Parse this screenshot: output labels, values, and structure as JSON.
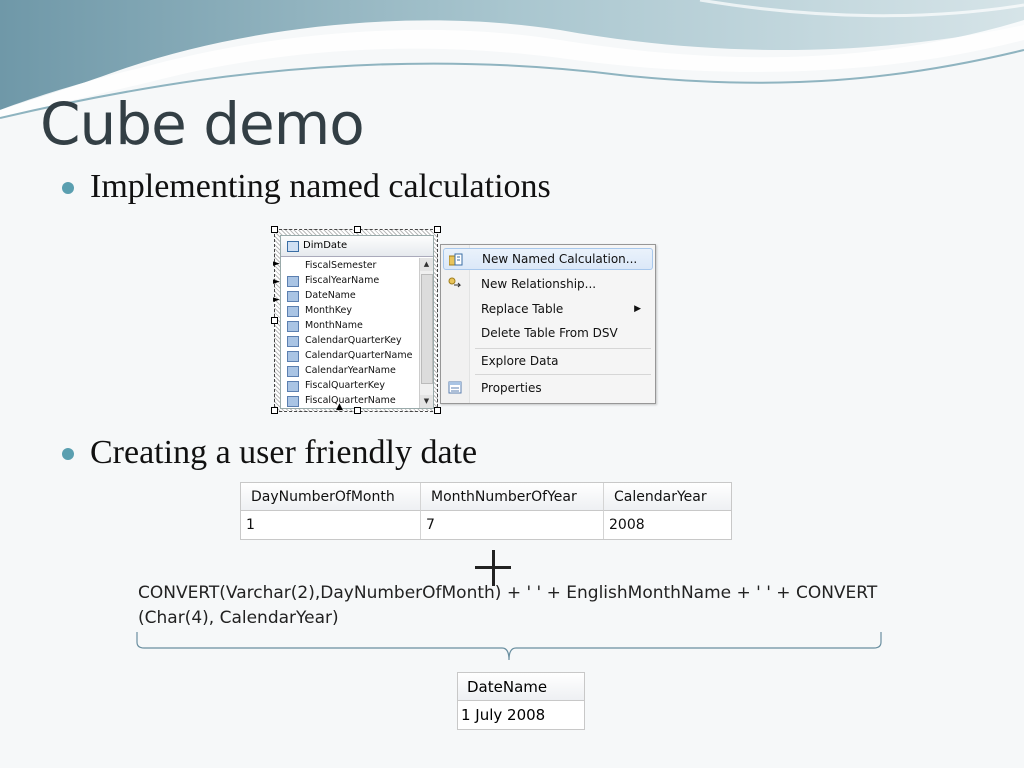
{
  "slide": {
    "title": "Cube demo",
    "bullets": [
      "Implementing named calculations",
      "Creating a user friendly date"
    ]
  },
  "designer": {
    "table_name": "DimDate",
    "columns": [
      "FiscalSemester",
      "FiscalYearName",
      "DateName",
      "MonthKey",
      "MonthName",
      "CalendarQuarterKey",
      "CalendarQuarterName",
      "CalendarYearName",
      "FiscalQuarterKey",
      "FiscalQuarterName"
    ]
  },
  "context_menu": {
    "items": [
      "New Named Calculation...",
      "New Relationship...",
      "Replace Table",
      "Delete Table From DSV",
      "Explore Data",
      "Properties"
    ]
  },
  "source_table": {
    "headers": [
      "DayNumberOfMonth",
      "MonthNumberOfYear",
      "CalendarYear"
    ],
    "row": [
      "1",
      "7",
      "2008"
    ]
  },
  "formula": {
    "line1": "CONVERT(Varchar(2),DayNumberOfMonth) + ' ' + EnglishMonthName + ' ' + CONVERT",
    "line2": "(Char(4), CalendarYear)"
  },
  "result_table": {
    "header": "DateName",
    "value": "1 July 2008"
  },
  "colors": {
    "title": "#333f45",
    "bullet": "#5a9fb0",
    "wave": "#7fa9b6"
  }
}
